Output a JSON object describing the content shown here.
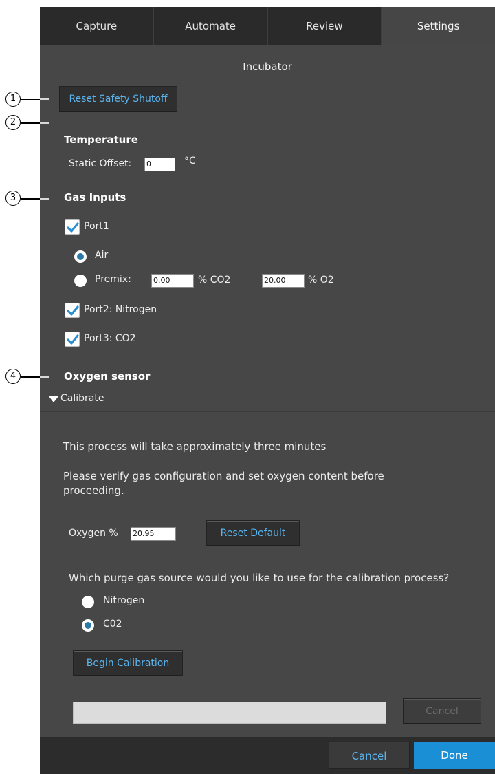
{
  "tabs": [
    {
      "label": "Capture"
    },
    {
      "label": "Automate"
    },
    {
      "label": "Review"
    },
    {
      "label": "Settings"
    }
  ],
  "section_title": "Incubator",
  "callouts": [
    "1",
    "2",
    "3",
    "4"
  ],
  "reset_safety_label": "Reset Safety Shutoff",
  "temperature": {
    "heading": "Temperature",
    "offset_label": "Static Offset:",
    "offset_value": "0",
    "unit": "°C"
  },
  "gas_inputs": {
    "heading": "Gas Inputs",
    "port1_label": "Port1",
    "port1_checked": true,
    "air_label": "Air",
    "premix_label": "Premix:",
    "co2_value": "0.00",
    "co2_unit": "% CO2",
    "o2_value": "20.00",
    "o2_unit": "% O2",
    "selected_source": "Air",
    "port2_label": "Port2: Nitrogen",
    "port2_checked": true,
    "port3_label": "Port3: CO2",
    "port3_checked": true
  },
  "oxygen_sensor": {
    "heading": "Oxygen sensor",
    "calibrate_label": "Calibrate",
    "calibrate_expanded": true,
    "info_text": "This process will take approximately three minutes",
    "verify_text": "Please verify gas configuration and set oxygen content before proceeding.",
    "oxygen_label": "Oxygen %",
    "oxygen_value": "20.95",
    "reset_default_label": "Reset Default",
    "purge_question": "Which purge gas source would you like to use for the calibration process?",
    "purge_options": [
      "Nitrogen",
      "C02"
    ],
    "purge_selected": "C02",
    "begin_label": "Begin Calibration",
    "progress_fraction": 0,
    "cancel_label": "Cancel"
  },
  "footer": {
    "cancel_label": "Cancel",
    "done_label": "Done"
  },
  "colors": {
    "accent": "#5ab4ee",
    "panel": "#474747",
    "tabbar": "#2a2a2a",
    "done_button": "#1b8fd6",
    "radio_selected": "#2a79a6",
    "check": "#2a8ed0"
  },
  "icons": [
    "checkmark-icon",
    "triangle-down-icon"
  ]
}
